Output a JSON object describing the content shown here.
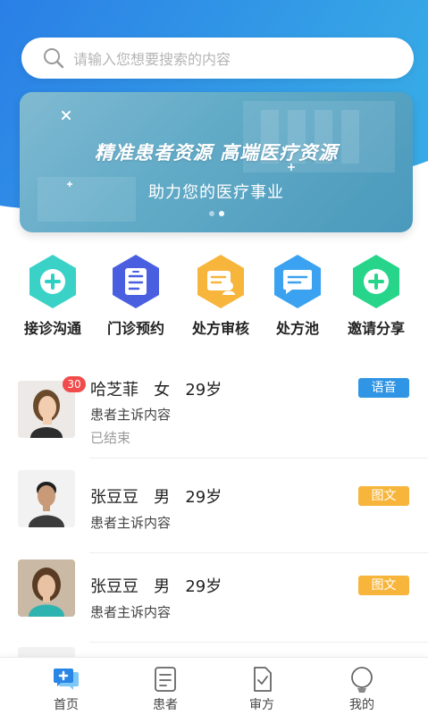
{
  "search": {
    "placeholder": "请输入您想要搜索的内容"
  },
  "banner": {
    "title": "精准患者资源  高端医疗资源",
    "subtitle": "助力您的医疗事业",
    "dots": 2,
    "active_dot": 1
  },
  "quick_actions": [
    {
      "label": "接诊沟通",
      "icon": "plus-circle-icon",
      "color": "#2fd0c4"
    },
    {
      "label": "门诊预约",
      "icon": "document-list-icon",
      "color": "#4a5fe0"
    },
    {
      "label": "处方审核",
      "icon": "prescription-user-icon",
      "color": "#f7b53b"
    },
    {
      "label": "处方池",
      "icon": "message-lines-icon",
      "color": "#3aa2f0"
    },
    {
      "label": "邀请分享",
      "icon": "plus-circle-icon",
      "color": "#27d58a"
    }
  ],
  "patients": [
    {
      "name": "哈芝菲   女   29岁",
      "desc": "患者主诉内容",
      "status": "已结束",
      "badge": "30",
      "tag": "语音",
      "tag_color": "#2f95e4"
    },
    {
      "name": "张豆豆   男   29岁",
      "desc": "患者主诉内容",
      "status": "",
      "badge": "",
      "tag": "图文",
      "tag_color": "#f7b53b"
    },
    {
      "name": "张豆豆   男   29岁",
      "desc": "患者主诉内容",
      "status": "",
      "badge": "",
      "tag": "图文",
      "tag_color": "#f7b53b"
    }
  ],
  "tabbar": [
    {
      "label": "首页",
      "icon": "home-chat-icon",
      "active": true
    },
    {
      "label": "患者",
      "icon": "patients-list-icon",
      "active": false
    },
    {
      "label": "审方",
      "icon": "review-check-icon",
      "active": false
    },
    {
      "label": "我的",
      "icon": "profile-icon",
      "active": false
    }
  ],
  "colors": {
    "header_blue": "#2d8ee8",
    "accent_teal": "#2fd0c4"
  }
}
